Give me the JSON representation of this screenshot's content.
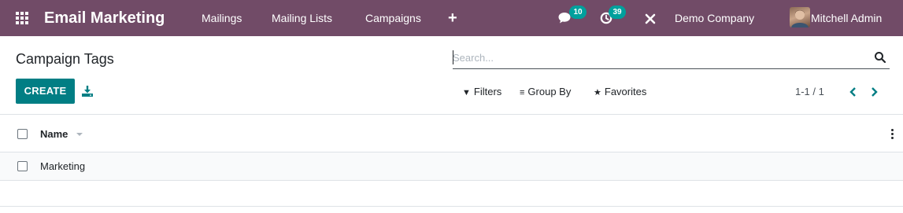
{
  "navbar": {
    "app_name": "Email Marketing",
    "menu": [
      "Mailings",
      "Mailing Lists",
      "Campaigns"
    ],
    "quick_create": "+",
    "messages_count": "10",
    "activities_count": "39",
    "company": "Demo Company",
    "user": "Mitchell Admin",
    "background_color": "#714B67",
    "badge_color": "#00A09D"
  },
  "control_panel": {
    "title": "Campaign Tags",
    "search_placeholder": "Search...",
    "create_label": "CREATE",
    "filters_label": "Filters",
    "group_by_label": "Group By",
    "favorites_label": "Favorites",
    "pager": "1-1 / 1",
    "primary_color": "#017E84"
  },
  "list": {
    "columns": [
      "Name"
    ],
    "rows": [
      {
        "name": "Marketing"
      }
    ]
  }
}
